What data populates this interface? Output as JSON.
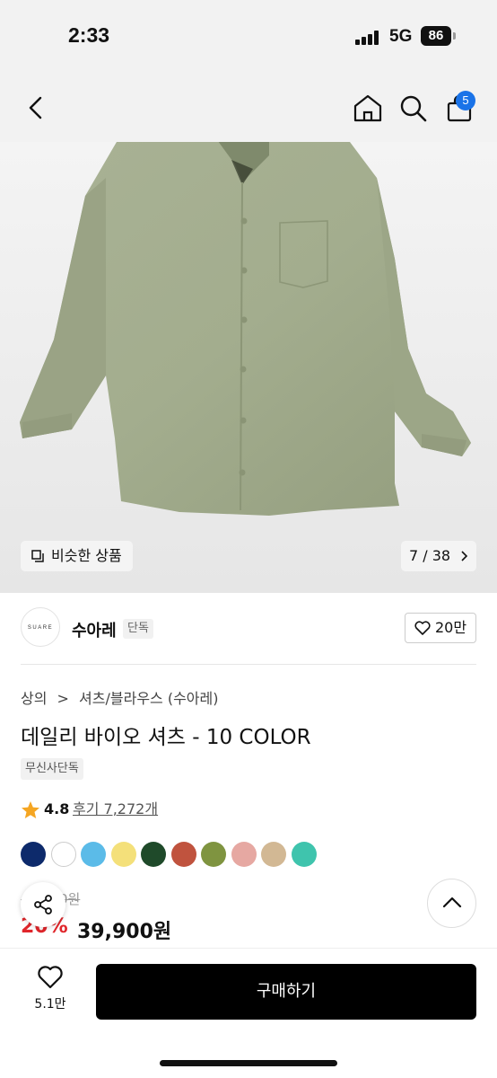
{
  "status": {
    "time": "2:33",
    "network": "5G",
    "battery": "86"
  },
  "nav": {
    "back_icon": "chevron-left-icon",
    "home_icon": "home-icon",
    "search_icon": "search-icon",
    "bag_icon": "shopping-bag-icon",
    "cart_count": "5"
  },
  "gallery": {
    "similar_label": "비슷한 상품",
    "pager": "7 / 38"
  },
  "brand": {
    "logo_text": "SUARE",
    "name": "수아레",
    "tag": "단독",
    "likes": "20만"
  },
  "product": {
    "breadcrumb": [
      "상의",
      ">",
      "셔츠/블라우스 (수아레)"
    ],
    "title": "데일리 바이오 셔츠 - 10 COLOR",
    "exclusive_tag": "무신사단독",
    "rating": "4.8",
    "reviews": "후기 7,272개",
    "colors": [
      "#0d2a6b",
      "#ffffff",
      "#5bbbe8",
      "#f4e07a",
      "#1f4a2a",
      "#c0533e",
      "#7f9440",
      "#e6a8a2",
      "#d2b894",
      "#3fc4ad"
    ],
    "original_price": "49,900원",
    "discount": "20%",
    "price": "39,900원"
  },
  "bottom": {
    "wishlist_count": "5.1만",
    "buy_label": "구매하기"
  },
  "theme": {
    "accent": "#1a73e8",
    "discount_color": "#e0262b",
    "shirt_color": "#a3ad8e"
  }
}
